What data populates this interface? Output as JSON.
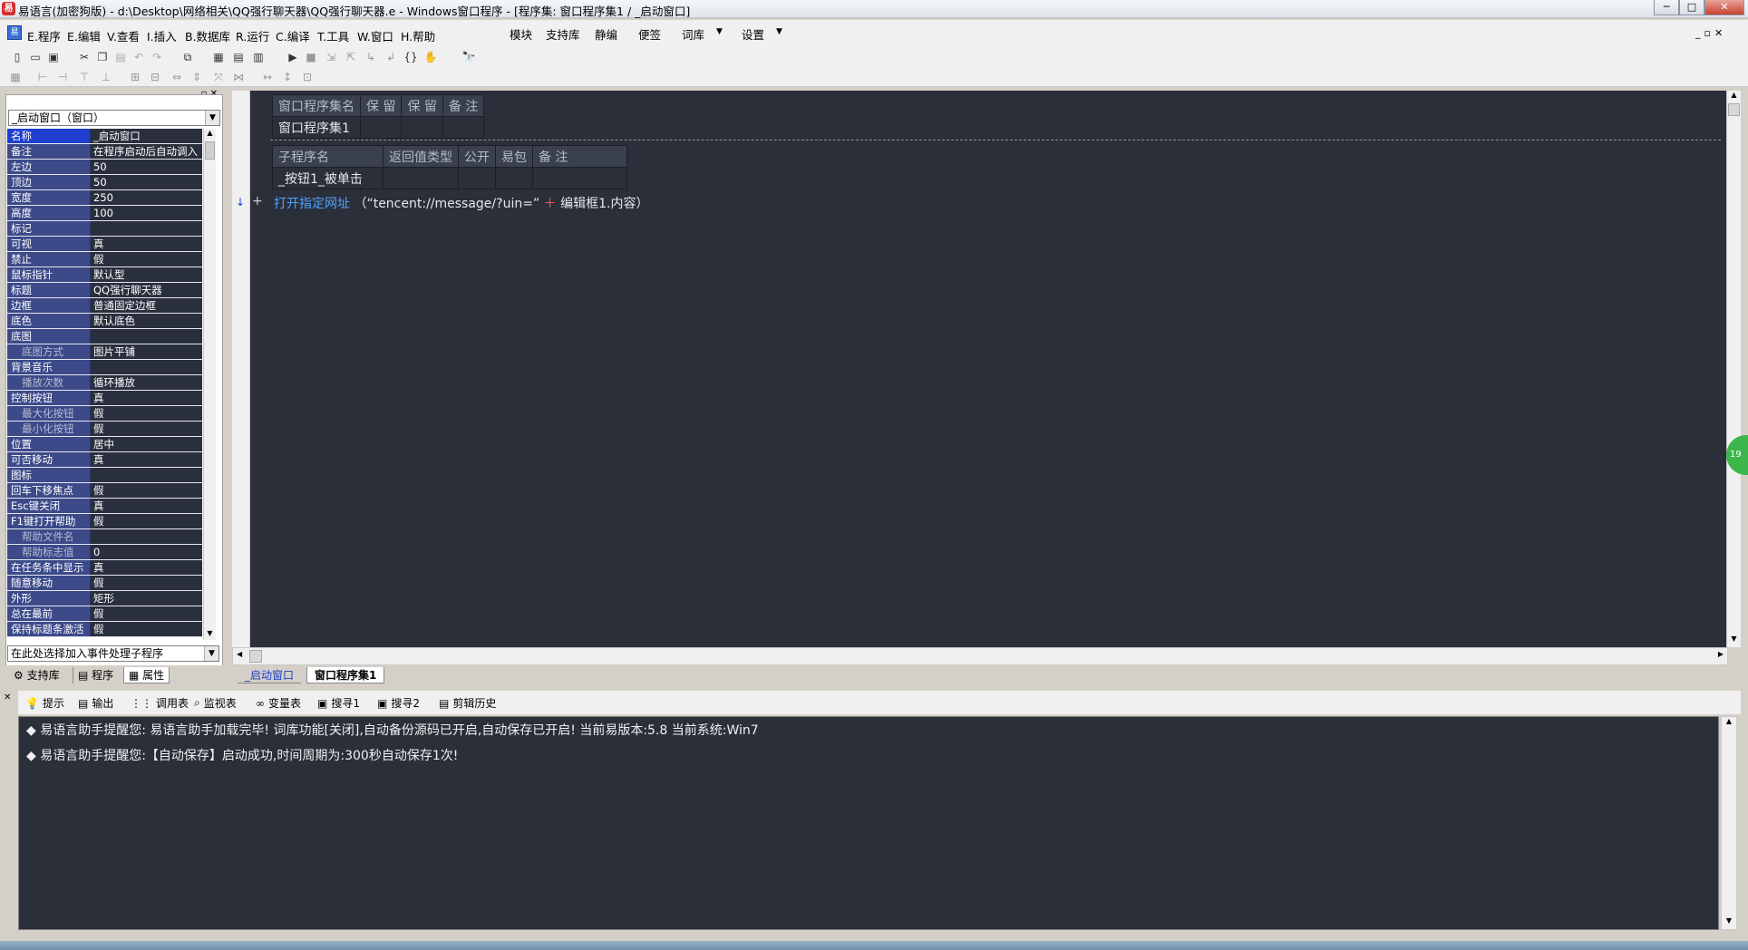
{
  "window": {
    "title": "易语言(加密狗版) - d:\\Desktop\\网络相关\\QQ强行聊天器\\QQ强行聊天器.e - Windows窗口程序 - [程序集: 窗口程序集1 / _启动窗口]",
    "controls": [
      "─",
      "□",
      "✕"
    ]
  },
  "menu": {
    "items": [
      "E.程序",
      "E.编辑",
      "V.查看",
      "I.插入",
      "B.数据库",
      "R.运行",
      "C.编译",
      "T.工具",
      "W.窗口",
      "H.帮助"
    ],
    "extra": [
      "模块",
      "支持库",
      "静编",
      "便签",
      "词库",
      "设置"
    ]
  },
  "left_panel": {
    "object_combo": "_启动窗口（窗口）",
    "properties": [
      {
        "name": "名称",
        "value": "_启动窗口",
        "selected": true
      },
      {
        "name": "备注",
        "value": "在程序启动后自动调入"
      },
      {
        "name": "左边",
        "value": "50"
      },
      {
        "name": "顶边",
        "value": "50"
      },
      {
        "name": "宽度",
        "value": "250"
      },
      {
        "name": "高度",
        "value": "100"
      },
      {
        "name": "标记",
        "value": ""
      },
      {
        "name": "可视",
        "value": "真"
      },
      {
        "name": "禁止",
        "value": "假"
      },
      {
        "name": "鼠标指针",
        "value": "默认型"
      },
      {
        "name": "标题",
        "value": "QQ强行聊天器"
      },
      {
        "name": "边框",
        "value": "普通固定边框"
      },
      {
        "name": "底色",
        "value": "默认底色"
      },
      {
        "name": "底图",
        "value": ""
      },
      {
        "name": "底图方式",
        "value": "图片平铺",
        "sub": true
      },
      {
        "name": "背景音乐",
        "value": ""
      },
      {
        "name": "播放次数",
        "value": "循环播放",
        "sub": true
      },
      {
        "name": "控制按钮",
        "value": "真"
      },
      {
        "name": "最大化按钮",
        "value": "假",
        "sub": true
      },
      {
        "name": "最小化按钮",
        "value": "假",
        "sub": true
      },
      {
        "name": "位置",
        "value": "居中"
      },
      {
        "name": "可否移动",
        "value": "真"
      },
      {
        "name": "图标",
        "value": ""
      },
      {
        "name": "回车下移焦点",
        "value": "假"
      },
      {
        "name": "Esc键关闭",
        "value": "真"
      },
      {
        "name": "F1键打开帮助",
        "value": "假"
      },
      {
        "name": "帮助文件名",
        "value": "",
        "sub": true
      },
      {
        "name": "帮助标志值",
        "value": "0",
        "sub": true
      },
      {
        "name": "在任务条中显示",
        "value": "真"
      },
      {
        "name": "随意移动",
        "value": "假"
      },
      {
        "name": "外形",
        "value": "矩形"
      },
      {
        "name": "总在最前",
        "value": "假"
      },
      {
        "name": "保持标题条激活",
        "value": "假"
      }
    ],
    "event_combo": "在此处选择加入事件处理子程序",
    "tabs": [
      "支持库",
      "程序",
      "属性"
    ]
  },
  "editor": {
    "assembly_table": {
      "headers": [
        "窗口程序集名",
        "保 留",
        "保 留",
        "备 注"
      ],
      "row": [
        "窗口程序集1",
        "",
        "",
        ""
      ]
    },
    "sub_table": {
      "headers": [
        "子程序名",
        "返回值类型",
        "公开",
        "易包",
        "备 注"
      ],
      "row": [
        "_按钮1_被单击",
        "",
        "",
        "",
        ""
      ]
    },
    "code": {
      "fn": "打开指定网址",
      "open": " （“tencent://message/?uin=” ",
      "op": "＋",
      "rest": " 编辑框1.内容）"
    },
    "tabs": [
      "_启动窗口",
      "窗口程序集1"
    ]
  },
  "output_panel": {
    "tabs": [
      "提示",
      "输出",
      "调用表",
      "监视表",
      "变量表",
      "搜寻1",
      "搜寻2",
      "剪辑历史"
    ],
    "lines": [
      "◆ 易语言助手提醒您:  易语言助手加载完毕! 词库功能[关闭],自动备份源码已开启,自动保存已开启! 当前易版本:5.8  当前系统:Win7",
      "◆ 易语言助手提醒您:【自动保存】启动成功,时间周期为:300秒自动保存1次!"
    ]
  },
  "badge": "19"
}
